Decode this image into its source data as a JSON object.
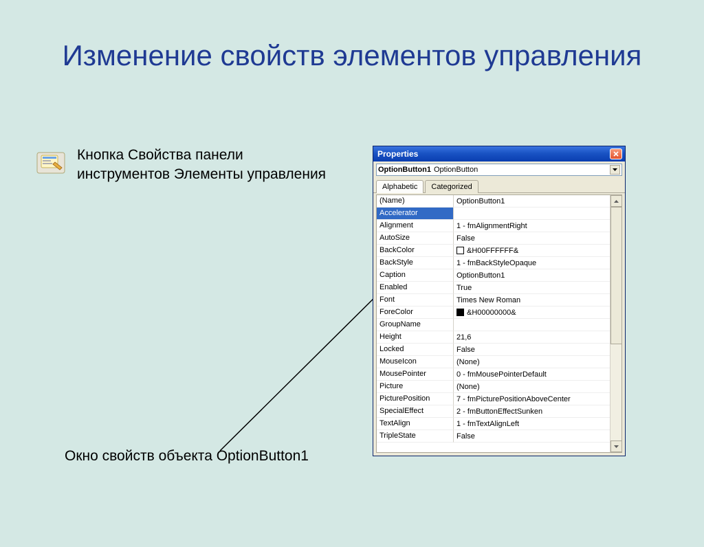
{
  "slide": {
    "title": "Изменение свойств элементов управления",
    "description": "Кнопка Свойства панели инструментов Элементы управления",
    "caption": "Окно свойств объекта OptionButton1"
  },
  "properties_window": {
    "title": "Properties",
    "object_name": "OptionButton1",
    "object_type": "OptionButton",
    "tabs": {
      "alphabetic": "Alphabetic",
      "categorized": "Categorized"
    },
    "selected_row_index": 1,
    "rows": [
      {
        "name": "(Name)",
        "value": "OptionButton1"
      },
      {
        "name": "Accelerator",
        "value": ""
      },
      {
        "name": "Alignment",
        "value": "1 - fmAlignmentRight"
      },
      {
        "name": "AutoSize",
        "value": "False"
      },
      {
        "name": "BackColor",
        "value": "&H00FFFFFF&",
        "swatch": "#ffffff"
      },
      {
        "name": "BackStyle",
        "value": "1 - fmBackStyleOpaque"
      },
      {
        "name": "Caption",
        "value": "OptionButton1"
      },
      {
        "name": "Enabled",
        "value": "True"
      },
      {
        "name": "Font",
        "value": "Times New Roman"
      },
      {
        "name": "ForeColor",
        "value": "&H00000000&",
        "swatch": "#000000"
      },
      {
        "name": "GroupName",
        "value": ""
      },
      {
        "name": "Height",
        "value": "21,6"
      },
      {
        "name": "Locked",
        "value": "False"
      },
      {
        "name": "MouseIcon",
        "value": "(None)"
      },
      {
        "name": "MousePointer",
        "value": "0 - fmMousePointerDefault"
      },
      {
        "name": "Picture",
        "value": "(None)"
      },
      {
        "name": "PicturePosition",
        "value": "7 - fmPicturePositionAboveCenter"
      },
      {
        "name": "SpecialEffect",
        "value": "2 - fmButtonEffectSunken"
      },
      {
        "name": "TextAlign",
        "value": "1 - fmTextAlignLeft"
      },
      {
        "name": "TripleState",
        "value": "False"
      }
    ]
  }
}
